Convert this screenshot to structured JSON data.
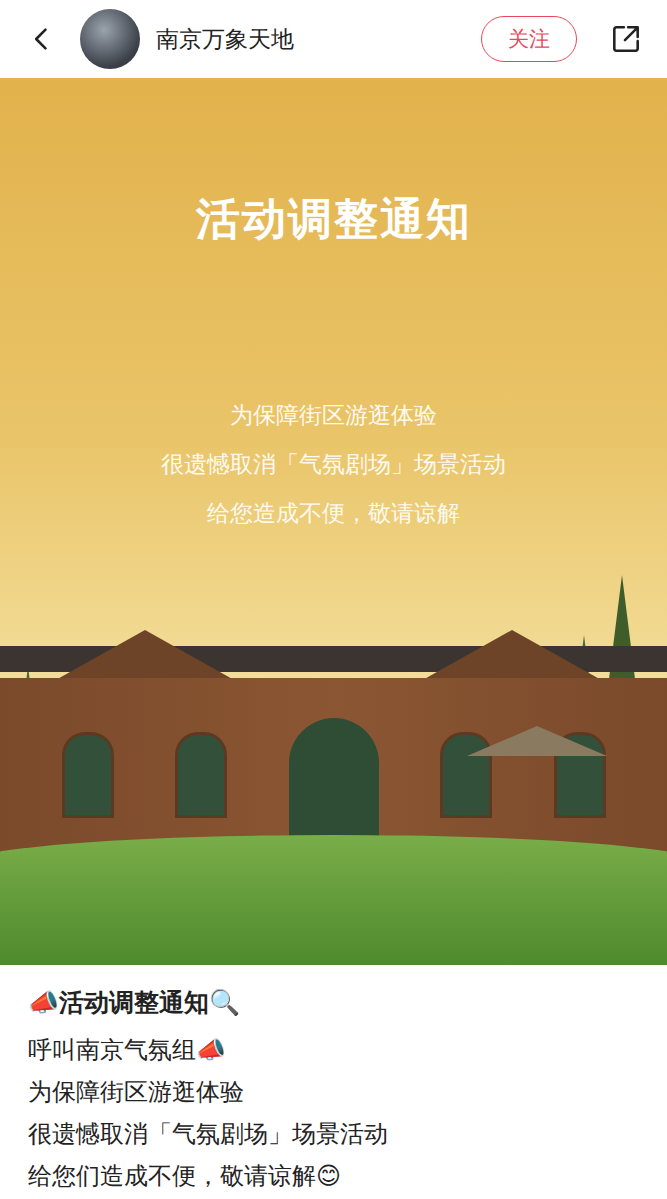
{
  "header": {
    "account_name": "南京万象天地",
    "follow_button": "关注"
  },
  "poster": {
    "title": "活动调整通知",
    "lines": [
      "为保障街区游逛体验",
      "很遗憾取消「气氛剧场」场景活动",
      "给您造成不便，敬请谅解"
    ]
  },
  "post": {
    "title": "📣活动调整通知🔍",
    "lines": [
      "呼叫南京气氛组📣",
      "为保障街区游逛体验",
      "很遗憾取消「气氛剧场」场景活动",
      "给您们造成不便，敬请谅解😊"
    ]
  }
}
